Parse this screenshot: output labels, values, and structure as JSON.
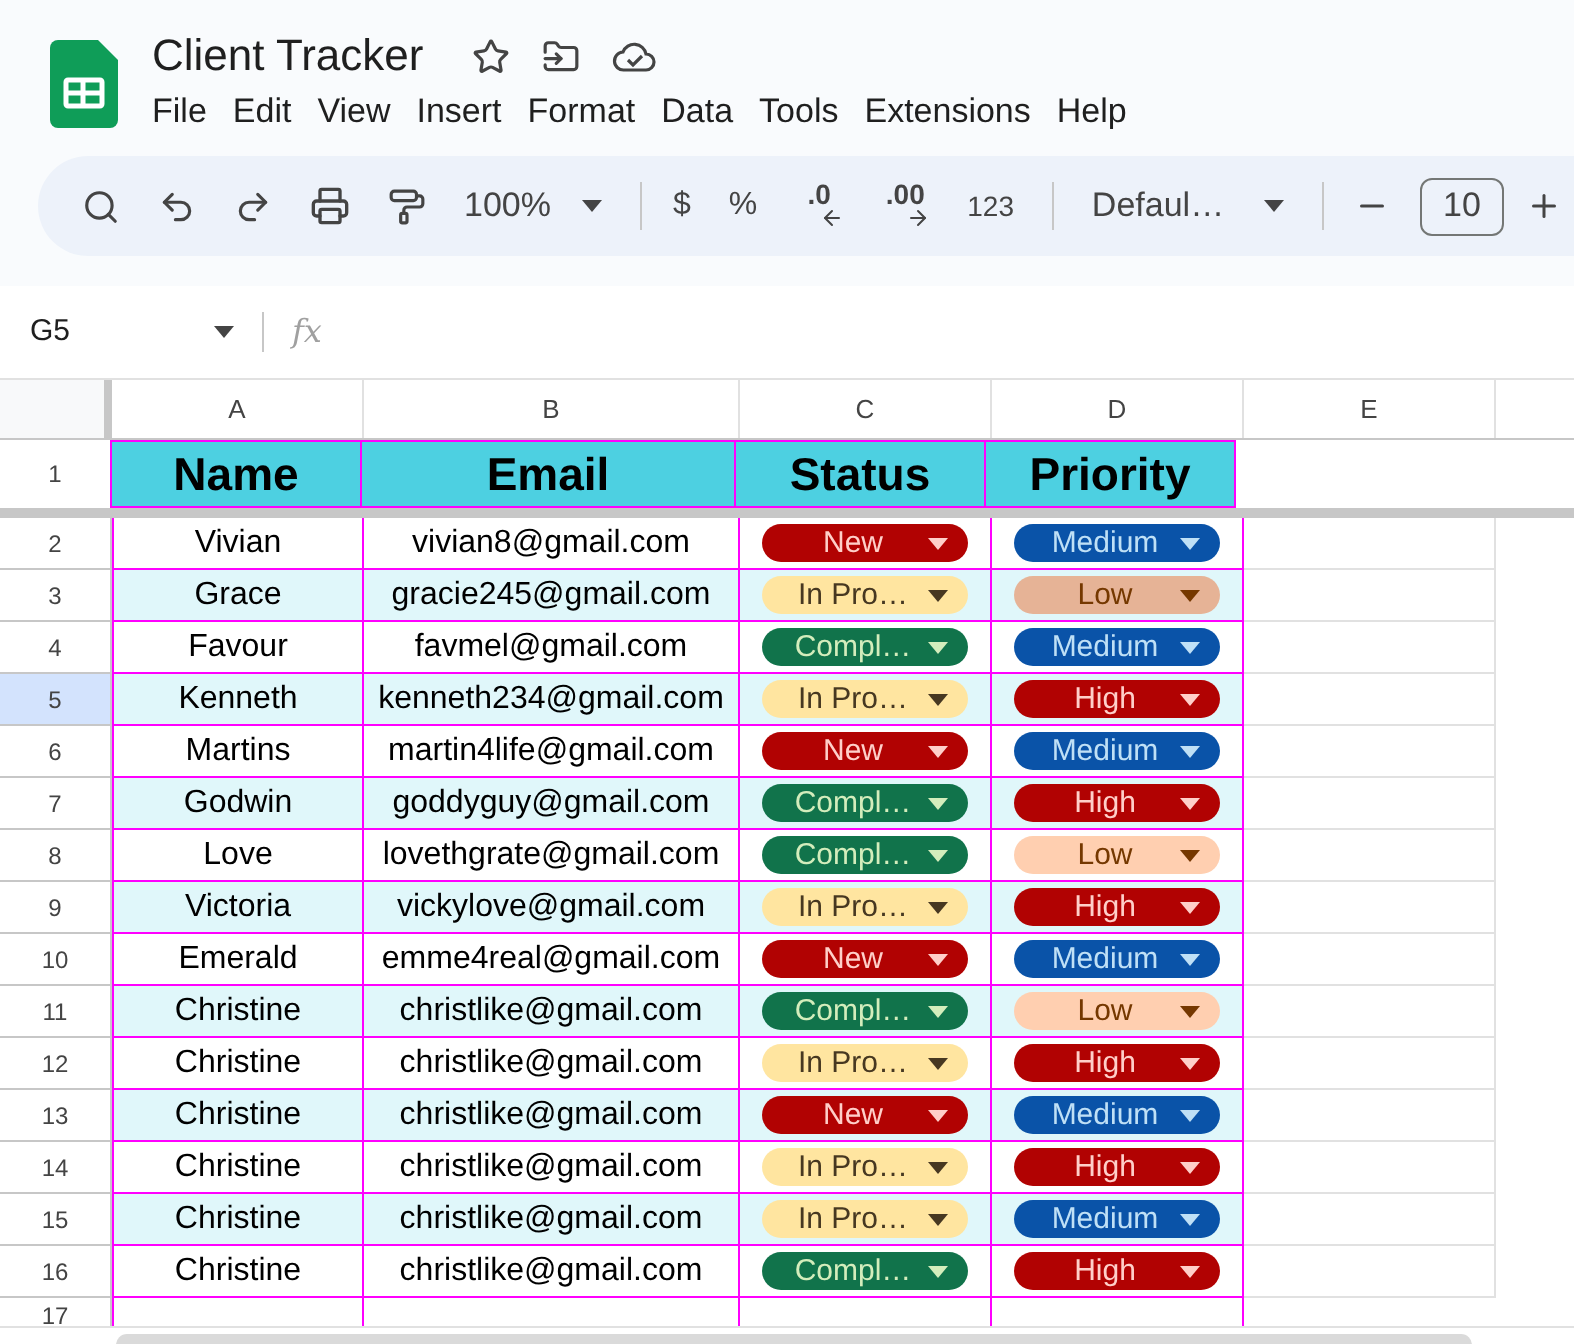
{
  "document": {
    "title": "Client Tracker"
  },
  "menu": [
    "File",
    "Edit",
    "View",
    "Insert",
    "Format",
    "Data",
    "Tools",
    "Extensions",
    "Help"
  ],
  "toolbar": {
    "zoom": "100%",
    "currency": "$",
    "percent": "%",
    "decrease_decimal": ".0",
    "increase_decimal": ".00",
    "number_format": "123",
    "font": "Defaul…",
    "font_size": "10"
  },
  "name_box": "G5",
  "formula_label": "fx",
  "columns": [
    {
      "label": "A",
      "selected": false
    },
    {
      "label": "B",
      "selected": false
    },
    {
      "label": "C",
      "selected": false
    },
    {
      "label": "D",
      "selected": false
    },
    {
      "label": "E",
      "selected": false
    }
  ],
  "header_row": {
    "number": "1",
    "cells": [
      "Name",
      "Email",
      "Status",
      "Priority"
    ]
  },
  "rows": [
    {
      "number": "2",
      "selected": false,
      "name": "Vivian",
      "email": "vivian8@gmail.com",
      "status": {
        "text": "New",
        "kind": "new",
        "color": "#b10202"
      },
      "priority": {
        "text": "Medium",
        "kind": "medium",
        "color": "#0a53a8"
      }
    },
    {
      "number": "3",
      "selected": false,
      "name": "Grace",
      "email": "gracie245@gmail.com",
      "status": {
        "text": "In Pro…",
        "kind": "progress",
        "color": "#ffe5a0"
      },
      "priority": {
        "text": "Low",
        "kind": "low",
        "color": "#e6b396"
      }
    },
    {
      "number": "4",
      "selected": false,
      "name": "Favour",
      "email": "favmel@gmail.com",
      "status": {
        "text": "Compl…",
        "kind": "complete",
        "color": "#11734b"
      },
      "priority": {
        "text": "Medium",
        "kind": "medium",
        "color": "#0a53a8"
      }
    },
    {
      "number": "5",
      "selected": true,
      "name": "Kenneth",
      "email": "kenneth234@gmail.com",
      "status": {
        "text": "In Pro…",
        "kind": "progress",
        "color": "#ffe5a0"
      },
      "priority": {
        "text": "High",
        "kind": "high",
        "color": "#b10202"
      }
    },
    {
      "number": "6",
      "selected": false,
      "name": "Martins",
      "email": "martin4life@gmail.com",
      "status": {
        "text": "New",
        "kind": "new",
        "color": "#b10202"
      },
      "priority": {
        "text": "Medium",
        "kind": "medium",
        "color": "#0a53a8"
      }
    },
    {
      "number": "7",
      "selected": false,
      "name": "Godwin",
      "email": "goddyguy@gmail.com",
      "status": {
        "text": "Compl…",
        "kind": "complete",
        "color": "#11734b"
      },
      "priority": {
        "text": "High",
        "kind": "high",
        "color": "#b10202"
      }
    },
    {
      "number": "8",
      "selected": false,
      "name": "Love",
      "email": "lovethgrate@gmail.com",
      "status": {
        "text": "Compl…",
        "kind": "complete",
        "color": "#11734b"
      },
      "priority": {
        "text": "Low",
        "kind": "low",
        "color": "#ffcfb0"
      }
    },
    {
      "number": "9",
      "selected": false,
      "name": "Victoria",
      "email": "vickylove@gmail.com",
      "status": {
        "text": "In Pro…",
        "kind": "progress",
        "color": "#ffe5a0"
      },
      "priority": {
        "text": "High",
        "kind": "high",
        "color": "#b10202"
      }
    },
    {
      "number": "10",
      "selected": false,
      "name": "Emerald",
      "email": "emme4real@gmail.com",
      "status": {
        "text": "New",
        "kind": "new",
        "color": "#b10202"
      },
      "priority": {
        "text": "Medium",
        "kind": "medium",
        "color": "#0a53a8"
      }
    },
    {
      "number": "11",
      "selected": false,
      "name": "Christine",
      "email": "christlike@gmail.com",
      "status": {
        "text": "Compl…",
        "kind": "complete",
        "color": "#11734b"
      },
      "priority": {
        "text": "Low",
        "kind": "low",
        "color": "#ffcfb0"
      }
    },
    {
      "number": "12",
      "selected": false,
      "name": "Christine",
      "email": "christlike@gmail.com",
      "status": {
        "text": "In Pro…",
        "kind": "progress",
        "color": "#ffe5a0"
      },
      "priority": {
        "text": "High",
        "kind": "high",
        "color": "#b10202"
      }
    },
    {
      "number": "13",
      "selected": false,
      "name": "Christine",
      "email": "christlike@gmail.com",
      "status": {
        "text": "New",
        "kind": "new",
        "color": "#b10202"
      },
      "priority": {
        "text": "Medium",
        "kind": "medium",
        "color": "#0a53a8"
      }
    },
    {
      "number": "14",
      "selected": false,
      "name": "Christine",
      "email": "christlike@gmail.com",
      "status": {
        "text": "In Pro…",
        "kind": "progress",
        "color": "#ffe5a0"
      },
      "priority": {
        "text": "High",
        "kind": "high",
        "color": "#b10202"
      }
    },
    {
      "number": "15",
      "selected": false,
      "name": "Christine",
      "email": "christlike@gmail.com",
      "status": {
        "text": "In Pro…",
        "kind": "progress",
        "color": "#ffe5a0"
      },
      "priority": {
        "text": "Medium",
        "kind": "medium",
        "color": "#0a53a8"
      }
    },
    {
      "number": "16",
      "selected": false,
      "name": "Christine",
      "email": "christlike@gmail.com",
      "status": {
        "text": "Compl…",
        "kind": "complete",
        "color": "#11734b"
      },
      "priority": {
        "text": "High",
        "kind": "high",
        "color": "#b10202"
      }
    }
  ],
  "empty_row": {
    "number": "17"
  }
}
